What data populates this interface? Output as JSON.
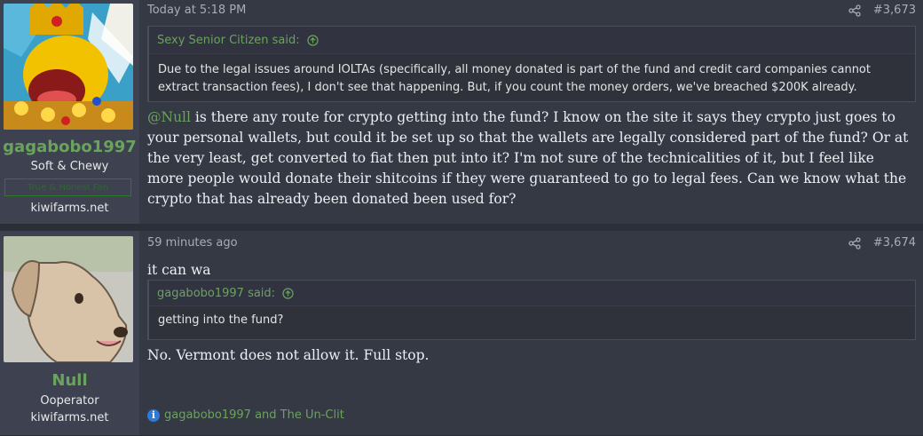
{
  "posts": [
    {
      "author": "gagabobo1997",
      "user_title": "Soft & Chewy",
      "user_banner": "True & Honest Fan",
      "site": "kiwifarms.net",
      "date": "Today at 5:18 PM",
      "post_number": "#3,673",
      "quote": {
        "author_line": "Sexy Senior Citizen said:",
        "text": "Due to the legal issues around IOLTAs (specifically, all money donated is part of the fund and credit card companies cannot extract transaction fees), I don't see that happening. But, if you count the money orders, we've breached $200K already."
      },
      "mention": "@Null",
      "body": " is there any route for crypto getting into the fund? I know on the site it says they crypto just goes to your personal wallets, but could it be set up so that the wallets are legally considered part of the fund? Or at the very least, get converted to fiat then put into it? I'm not sure of the technicalities of it, but I feel like more people would donate their shitcoins if they were guaranteed to go to legal fees. Can we know what the crypto that has already been donated been used for?"
    },
    {
      "author": "Null",
      "user_title": "Ooperator",
      "site": "kiwifarms.net",
      "date": "59 minutes ago",
      "post_number": "#3,674",
      "intro": "it can wa",
      "quote": {
        "author_line": "gagabobo1997 said:",
        "text": "getting into the fund?"
      },
      "body": "No. Vermont does not allow it. Full stop.",
      "reactions": "gagabobo1997 and The Un-Clit"
    }
  ],
  "icons": {
    "share": "share-icon",
    "quote_jump": "arrow-up-circle-icon",
    "info": "info-icon"
  },
  "colors": {
    "accent": "#6aa35d",
    "background": "#353944",
    "sidebar": "#3e4250"
  }
}
